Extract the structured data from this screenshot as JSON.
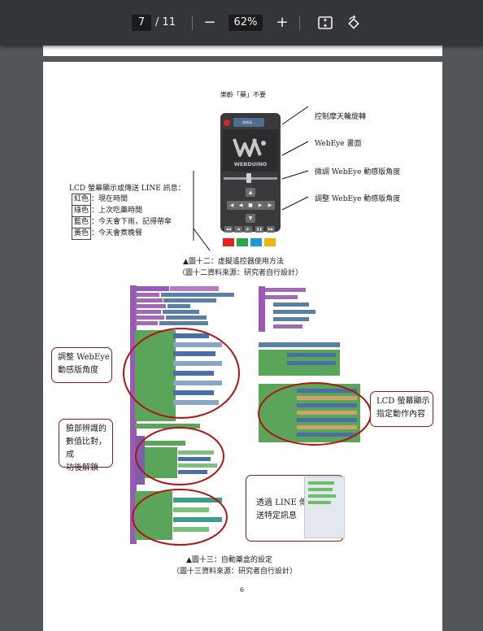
{
  "viewer": {
    "current_page": "7",
    "total_pages": "/ 11",
    "zoom": "62%",
    "zoom_out_label": "−",
    "zoom_in_label": "+"
  },
  "doc": {
    "header": "樂齡「藥」不要",
    "remote_title_bar": "按鈕區...",
    "remote_brand": "WEBDUINO",
    "right_labels": [
      "控制摩天輪旋轉",
      "WebEye 畫面",
      "微調 WebEye 動感版角度",
      "調整 WebEye 動感版角度"
    ],
    "lcd_title": "LCD 螢幕顯示或傳送 LINE 訊息：",
    "color_rows": [
      {
        "color": "紅色",
        "text": "：現在時間"
      },
      {
        "color": "綠色",
        "text": "：上次吃藥時間"
      },
      {
        "color": "藍色",
        "text": "：今天會下雨，記得帶傘"
      },
      {
        "color": "黃色",
        "text": "：今天會煮晚餐"
      }
    ],
    "fig12_caption": "▲圖十二：虛擬遙控器使用方法",
    "fig12_source": "（圖十二資料來源：研究者自行設計）",
    "callouts": {
      "webeye_line1": "調整 WebEye",
      "webeye_line2": "動感版角度",
      "lcd_line1": "LCD 螢幕顯示",
      "lcd_line2": "指定動作內容",
      "face_line1": "臉部辨識的",
      "face_line2": "數值比對，成",
      "face_line3": "功後解鎖",
      "line_line1": "透過 LINE 傳",
      "line_line2": "送特定訊息"
    },
    "fig13_caption": "▲圖十三：自動藥盒的設定",
    "fig13_source": "（圖十三資料來源：研究者自行設計）",
    "page_number": "6"
  },
  "colors": {
    "accent_red": "#8c1b1b",
    "block_purple": "#9b59b6",
    "block_green": "#5ba55b",
    "block_blue": "#4a6fa5"
  }
}
